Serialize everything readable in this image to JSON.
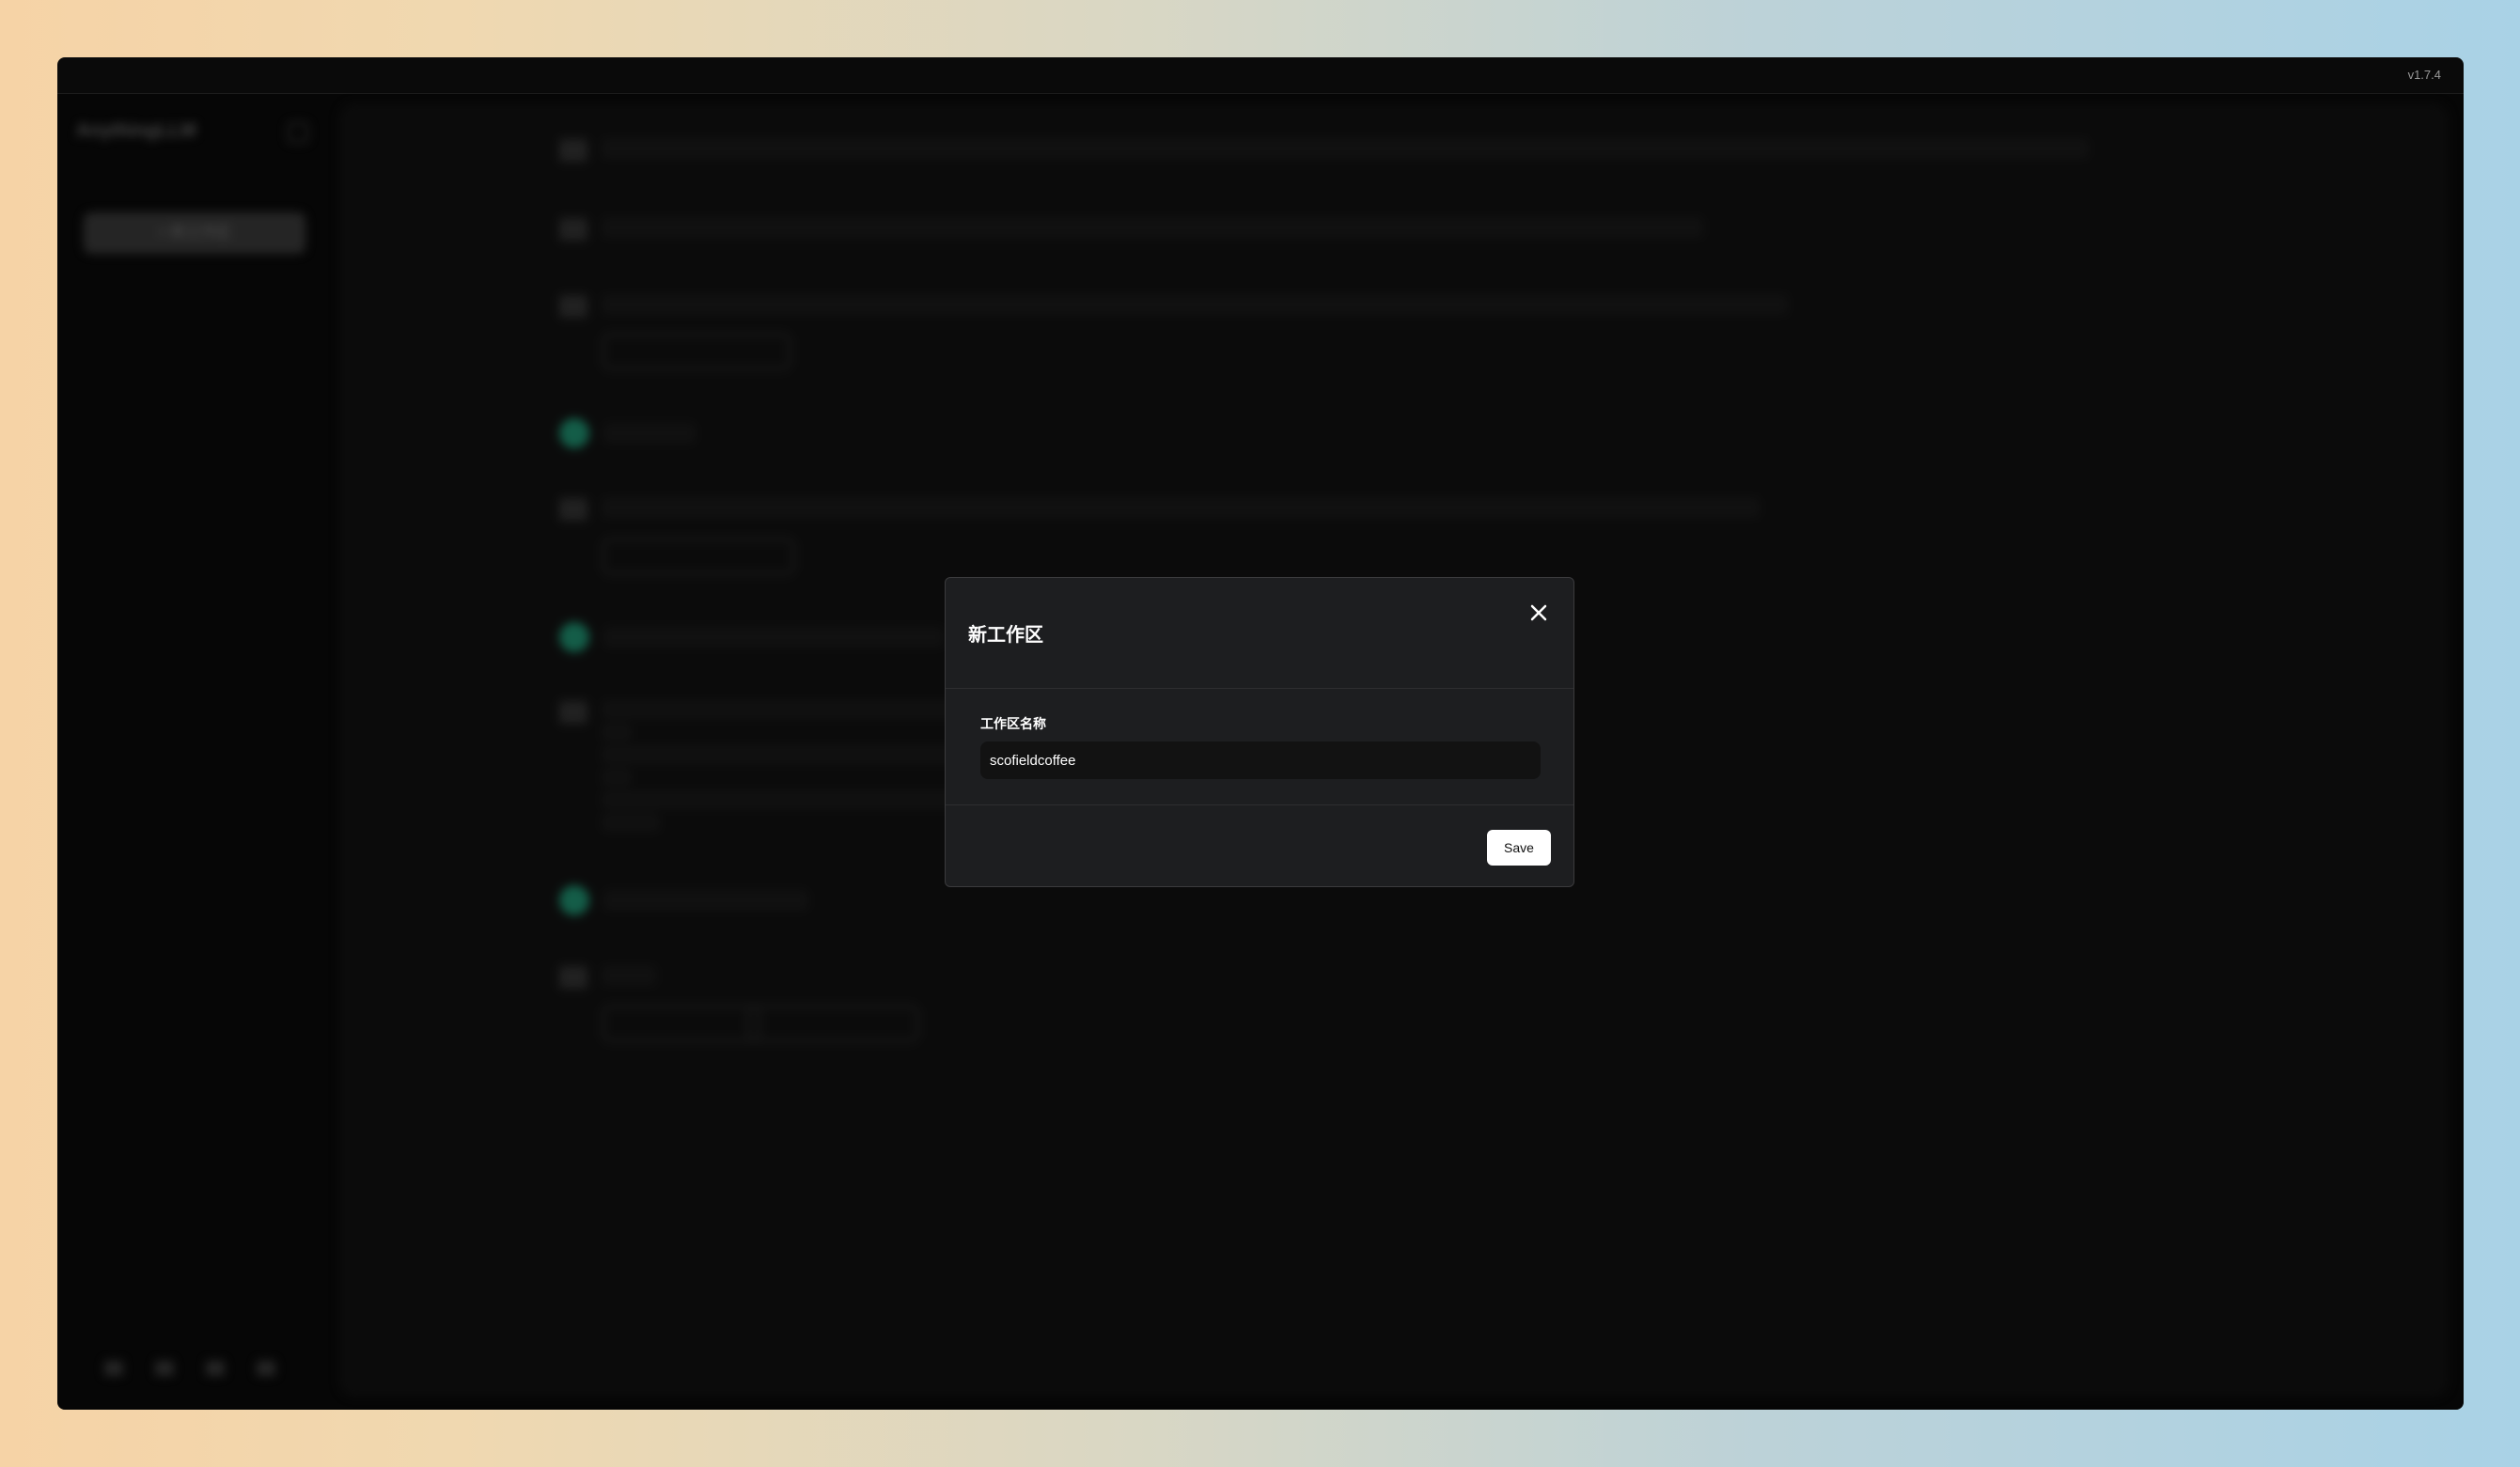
{
  "app": {
    "version": "v1.7.4",
    "brand": "AnythingLLM",
    "new_workspace_button": "+ 新工作区"
  },
  "dialog": {
    "title": "新工作区",
    "close_icon": "close-icon",
    "name_label": "工作区名称",
    "name_value": "scofieldcoffee",
    "save_label": "Save"
  },
  "colors": {
    "modal_bg": "#1d1e20",
    "input_bg": "#121212",
    "save_button_bg": "#ffffff",
    "user_avatar": "#1f8f6f"
  }
}
